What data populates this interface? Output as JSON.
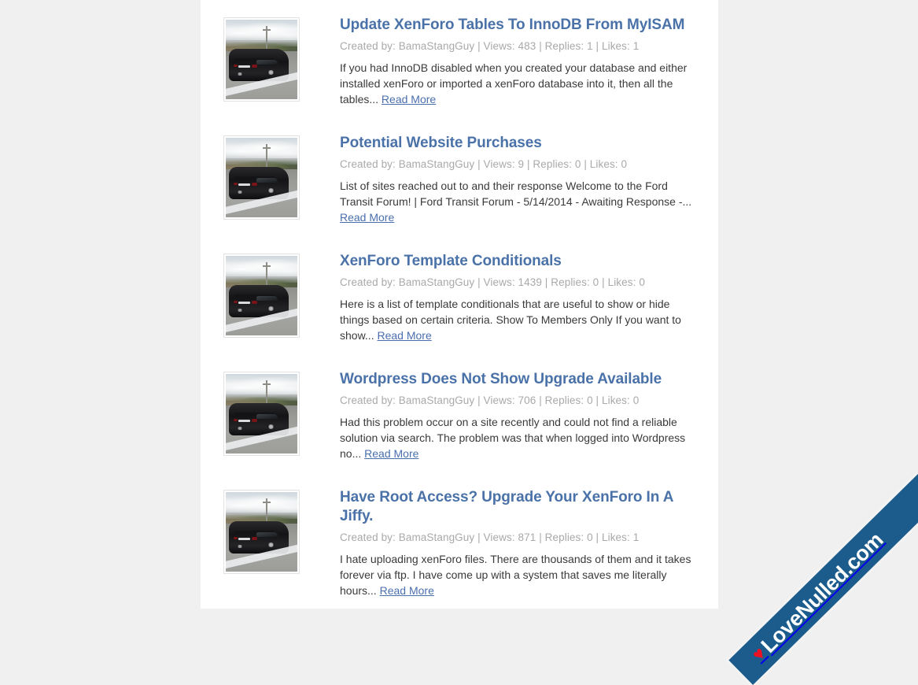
{
  "colors": {
    "page_background": "#f0f0f0",
    "content_background": "#ffffff",
    "title_link": "#4a72a8",
    "meta_text": "#a9a9a9",
    "body_text": "#3a3a3a",
    "read_more_link": "#4a6fae",
    "ribbon_blue": "#1c5c8c",
    "heart_red": "#ee1122"
  },
  "read_more_label": "Read More",
  "threads": [
    {
      "title": "Update XenForo Tables To InnoDB From MyISAM",
      "meta": "Created by: BamaStangGuy | Views: 483 | Replies: 1 | Likes: 1",
      "author": "BamaStangGuy",
      "views": "483",
      "replies": "1",
      "likes": "1",
      "snippet": "If you had InnoDB disabled when you created your database and either installed xenForo or imported a xenForo database into it, then all the tables...",
      "thumb_alt": "black-mustang-rear-view-photo"
    },
    {
      "title": "Potential Website Purchases",
      "meta": "Created by: BamaStangGuy | Views: 9 | Replies: 0 | Likes: 0",
      "author": "BamaStangGuy",
      "views": "9",
      "replies": "0",
      "likes": "0",
      "snippet": "List of sites reached out to and their response Welcome to the Ford Transit Forum! | Ford Transit Forum - 5/14/2014 - Awaiting Response -...",
      "thumb_alt": "black-mustang-rear-view-photo"
    },
    {
      "title": "XenForo Template Conditionals",
      "meta": "Created by: BamaStangGuy | Views: 1439 | Replies: 0 | Likes: 0",
      "author": "BamaStangGuy",
      "views": "1439",
      "replies": "0",
      "likes": "0",
      "snippet": "Here is a list of template conditionals that are useful to show or hide things based on certain criteria. Show To Members Only If you want to show...",
      "thumb_alt": "black-mustang-rear-view-photo"
    },
    {
      "title": "Wordpress Does Not Show Upgrade Available",
      "meta": "Created by: BamaStangGuy | Views: 706 | Replies: 0 | Likes: 0",
      "author": "BamaStangGuy",
      "views": "706",
      "replies": "0",
      "likes": "0",
      "snippet": "Had this problem occur on a site recently and could not find a reliable solution via search. The problem was that when logged into Wordpress no...",
      "thumb_alt": "black-mustang-rear-view-photo"
    },
    {
      "title": "Have Root Access? Upgrade Your XenForo In A Jiffy.",
      "meta": "Created by: BamaStangGuy | Views: 871 | Replies: 0 | Likes: 1",
      "author": "BamaStangGuy",
      "views": "871",
      "replies": "0",
      "likes": "1",
      "snippet": "I hate uploading xenForo files. There are thousands of them and it takes forever via ftp. I have come up with a system that saves me literally hours...",
      "thumb_alt": "black-mustang-rear-view-photo"
    }
  ],
  "ribbon": {
    "text": "LoveNulled.com",
    "heart_glyph": "♥"
  }
}
